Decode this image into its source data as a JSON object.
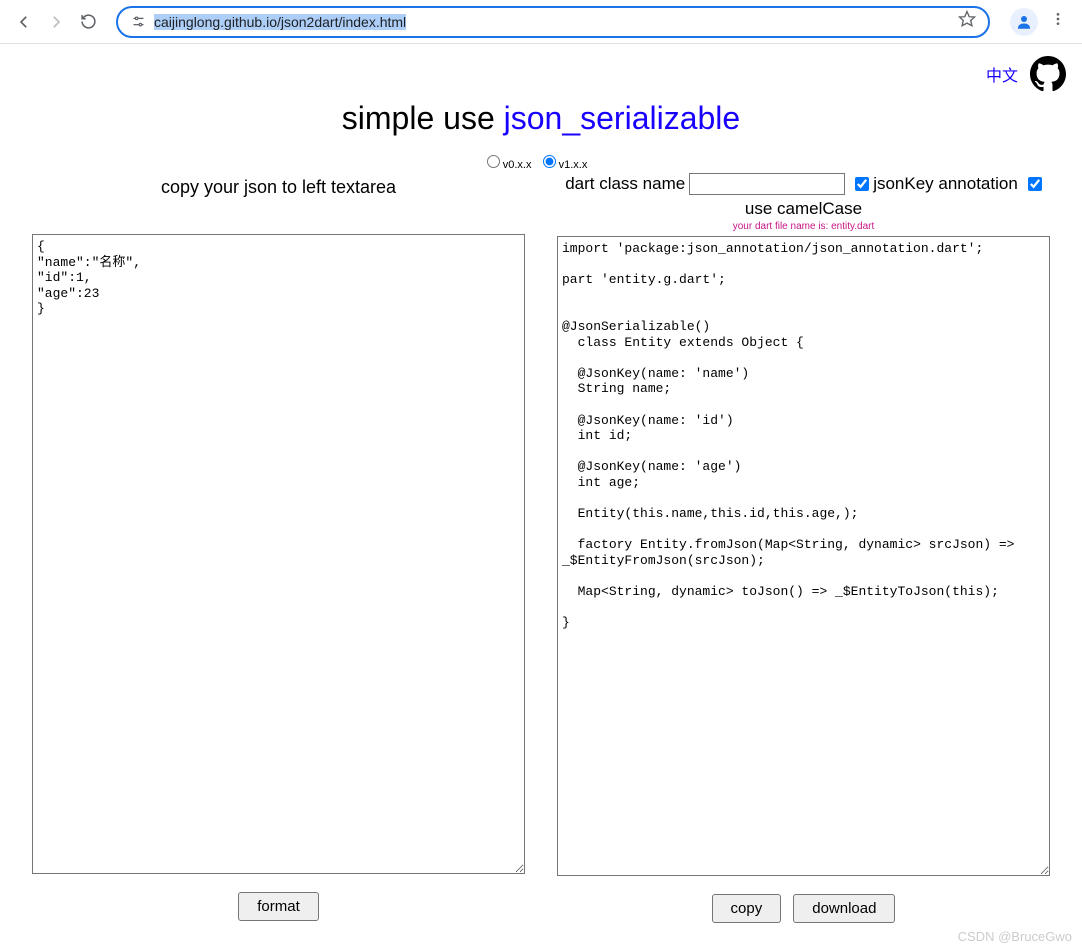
{
  "browser": {
    "url_display": "caijinglong.github.io/json2dart/index.html"
  },
  "header": {
    "lang_link": "中文"
  },
  "title": {
    "prefix": "simple use ",
    "link": "json_serializable"
  },
  "versions": {
    "v0": "v0.x.x",
    "v1": "v1.x.x"
  },
  "left": {
    "heading": "copy your json to left textarea",
    "content": "{\n\"name\":\"名称\",\n\"id\":1,\n\"age\":23\n}",
    "format_btn": "format"
  },
  "right": {
    "class_label": "dart class name",
    "class_value": "",
    "jsonkey_label": "jsonKey annotation",
    "camel_label": "use camelCase",
    "filename_hint": "your dart file name is: entity.dart",
    "content": "import 'package:json_annotation/json_annotation.dart'; \n  \npart 'entity.g.dart';\n\n\n@JsonSerializable()\n  class Entity extends Object {\n\n  @JsonKey(name: 'name')\n  String name;\n\n  @JsonKey(name: 'id')\n  int id;\n\n  @JsonKey(name: 'age')\n  int age;\n\n  Entity(this.name,this.id,this.age,);\n\n  factory Entity.fromJson(Map<String, dynamic> srcJson) => _$EntityFromJson(srcJson);\n\n  Map<String, dynamic> toJson() => _$EntityToJson(this);\n\n}\n\n  ",
    "copy_btn": "copy",
    "download_btn": "download"
  },
  "watermark": "CSDN @BruceGwo"
}
